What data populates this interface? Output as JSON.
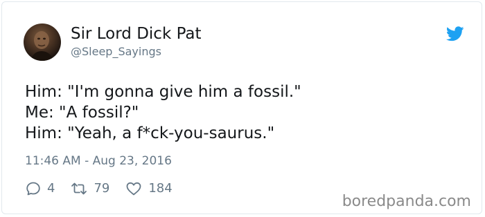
{
  "author": {
    "display_name": "Sir Lord Dick Pat",
    "handle": "@Sleep_Sayings"
  },
  "tweet": {
    "lines": [
      "Him: \"I'm gonna give him a fossil.\"",
      "Me: \"A fossil?\"",
      "Him: \"Yeah, a f*ck-you-saurus.\""
    ],
    "timestamp": "11:46 AM - Aug 23, 2016"
  },
  "actions": {
    "replies": "4",
    "retweets": "79",
    "likes": "184"
  },
  "watermark": "boredpanda.com",
  "colors": {
    "twitter_blue": "#1da1f2",
    "secondary_text": "#657786",
    "primary_text": "#14171a"
  },
  "icons": {
    "brand": "twitter-bird-icon",
    "reply": "reply-icon",
    "retweet": "retweet-icon",
    "like": "heart-icon"
  }
}
